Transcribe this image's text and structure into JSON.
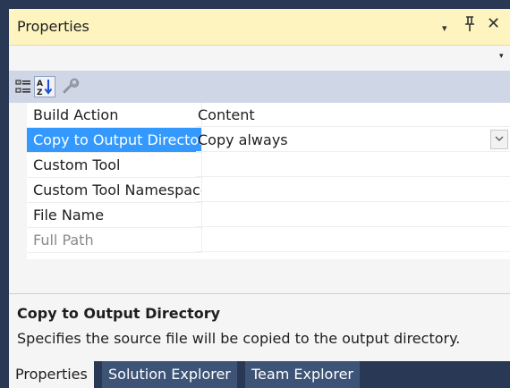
{
  "window": {
    "title": "Properties",
    "dropdown_glyph": "▾",
    "pin_glyph": "𝟦",
    "close_glyph": "✕"
  },
  "object_selector": {
    "value": "",
    "arrow": "▾"
  },
  "toolbar": {
    "buttons": [
      {
        "name": "categorized",
        "icon": "categorized-icon",
        "pressed": false
      },
      {
        "name": "alphabetical",
        "icon": "sort-az-icon",
        "pressed": true
      },
      {
        "name": "property-pages",
        "icon": "wrench-icon",
        "pressed": false,
        "enabled": false
      }
    ]
  },
  "properties": [
    {
      "name": "Build Action",
      "value": "Content",
      "selected": false,
      "disabled": false
    },
    {
      "name": "Copy to Output Directory",
      "value": "Copy always",
      "selected": true,
      "disabled": false
    },
    {
      "name": "Custom Tool",
      "value": "",
      "selected": false,
      "disabled": false
    },
    {
      "name": "Custom Tool Namespace",
      "value": "",
      "selected": false,
      "disabled": false
    },
    {
      "name": "File Name",
      "value": "",
      "selected": false,
      "disabled": false
    },
    {
      "name": "Full Path",
      "value": "",
      "selected": false,
      "disabled": true
    }
  ],
  "description": {
    "title": "Copy to Output Directory",
    "text": "Specifies the source file will be copied to the output directory."
  },
  "tabs": [
    {
      "label": "Properties",
      "active": true
    },
    {
      "label": "Solution Explorer",
      "active": false
    },
    {
      "label": "Team Explorer",
      "active": false
    }
  ],
  "colors": {
    "title_bar": "#fdf4bf",
    "selection": "#3399ff",
    "tab_strip": "#293955",
    "toolbar": "#cfd6e5"
  }
}
